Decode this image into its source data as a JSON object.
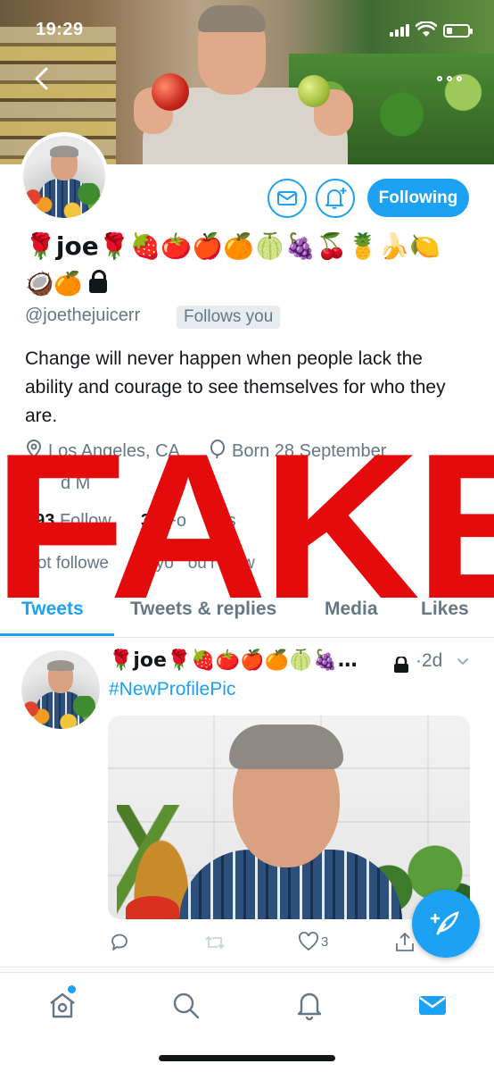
{
  "status_bar": {
    "time": "19:29"
  },
  "profile": {
    "display_name": "🌹joe🌹🍓🍅🍎🍊🍈🍇🍒🍍🍌🍋",
    "display_name_line2": "🥥🍊",
    "handle": "@joethejuicerr",
    "follows_you": "Follows you",
    "bio": "Change will never happen when people lack the ability and courage to see themselves for who they are.",
    "location": "Los Angeles, CA",
    "birthday": "Born 28 September",
    "joined_fragment": "d M",
    "following_count": "493",
    "following_label_fragment": "Follow",
    "followers_count": "34",
    "followers_label_fragment": "Fo     ers",
    "not_followed": "Not followe      anyo   ou’r  llow"
  },
  "buttons": {
    "following": "Following"
  },
  "overlay": {
    "text": "FAKE",
    "color": "#e30b0b"
  },
  "tabs": [
    {
      "label": "Tweets",
      "active": true
    },
    {
      "label": "Tweets & replies",
      "active": false
    },
    {
      "label": "Media",
      "active": false
    },
    {
      "label": "Likes",
      "active": false
    }
  ],
  "tweet": {
    "author": "🌹joe🌹🍓🍅🍎🍊🍈🍇…",
    "time": "·2d",
    "hashtag": "#NewProfilePic",
    "like_count": "3"
  },
  "colors": {
    "accent": "#1da1f2",
    "secondary_text": "#657786",
    "primary_text": "#14171a"
  },
  "icons": {
    "back": "chevron-left-icon",
    "more": "more-dots-icon",
    "message": "envelope-icon",
    "notify": "bell-plus-icon",
    "location": "map-pin-icon",
    "birthday": "balloon-icon",
    "reply": "reply-icon",
    "retweet": "retweet-icon",
    "like": "heart-icon",
    "share": "share-icon",
    "compose": "compose-feather-icon",
    "nav_home": "home-icon",
    "nav_search": "search-icon",
    "nav_notifications": "bell-icon",
    "nav_messages": "envelope-icon"
  }
}
